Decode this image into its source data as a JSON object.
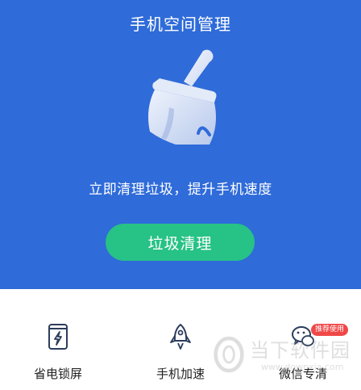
{
  "header": {
    "title": "手机空间管理"
  },
  "hero": {
    "icon": "broom-icon",
    "subtitle": "立即清理垃圾，提升手机速度",
    "button_label": "垃圾清理"
  },
  "tools": [
    {
      "label": "省电锁屏",
      "icon": "battery-lock-icon"
    },
    {
      "label": "手机加速",
      "icon": "rocket-icon"
    },
    {
      "label": "微信专清",
      "icon": "wechat-icon",
      "badge": "推荐使用"
    }
  ],
  "watermark": {
    "text": "当下软件园",
    "url": "www.downxia.com"
  },
  "colors": {
    "hero_bg": "#2f6bd9",
    "button_bg": "#27c285",
    "badge_bg": "#f04848"
  }
}
